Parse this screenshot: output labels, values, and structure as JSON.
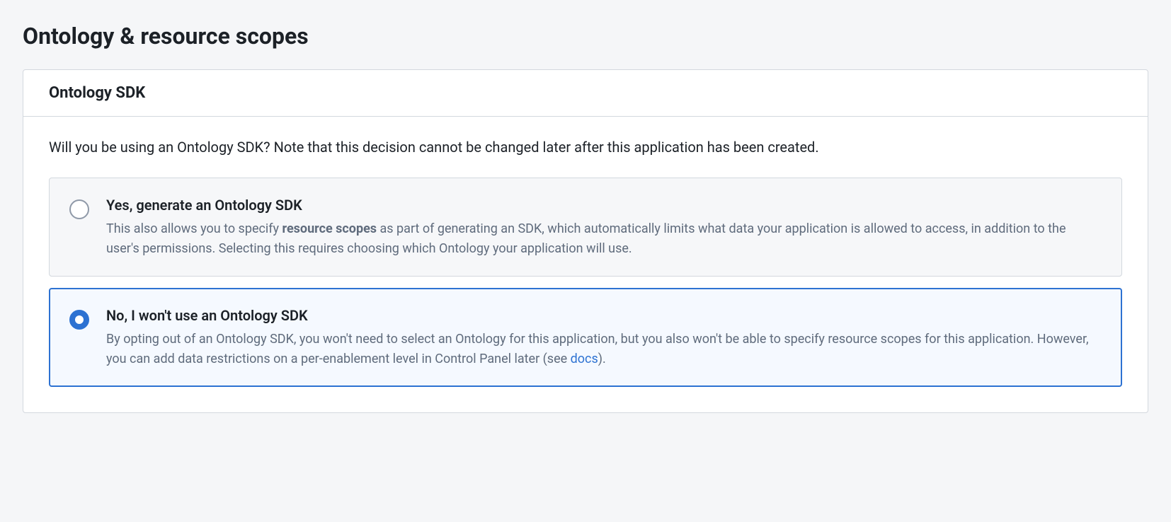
{
  "page": {
    "title": "Ontology & resource scopes"
  },
  "card": {
    "header": "Ontology SDK",
    "question": "Will you be using an Ontology SDK? Note that this decision cannot be changed later after this application has been created.",
    "options": [
      {
        "title": "Yes, generate an Ontology SDK",
        "desc_prefix": "This also allows you to specify ",
        "desc_bold": "resource scopes",
        "desc_suffix": " as part of generating an SDK, which automatically limits what data your application is allowed to access, in addition to the user's permissions. Selecting this requires choosing which Ontology your application will use.",
        "selected": false
      },
      {
        "title": "No, I won't use an Ontology SDK",
        "desc_prefix": "By opting out of an Ontology SDK, you won't need to select an Ontology for this application, but you also won't be able to specify resource scopes for this application. However, you can add data restrictions on a per-enablement level in Control Panel later (see ",
        "desc_link": "docs",
        "desc_suffix2": ").",
        "selected": true
      }
    ]
  }
}
